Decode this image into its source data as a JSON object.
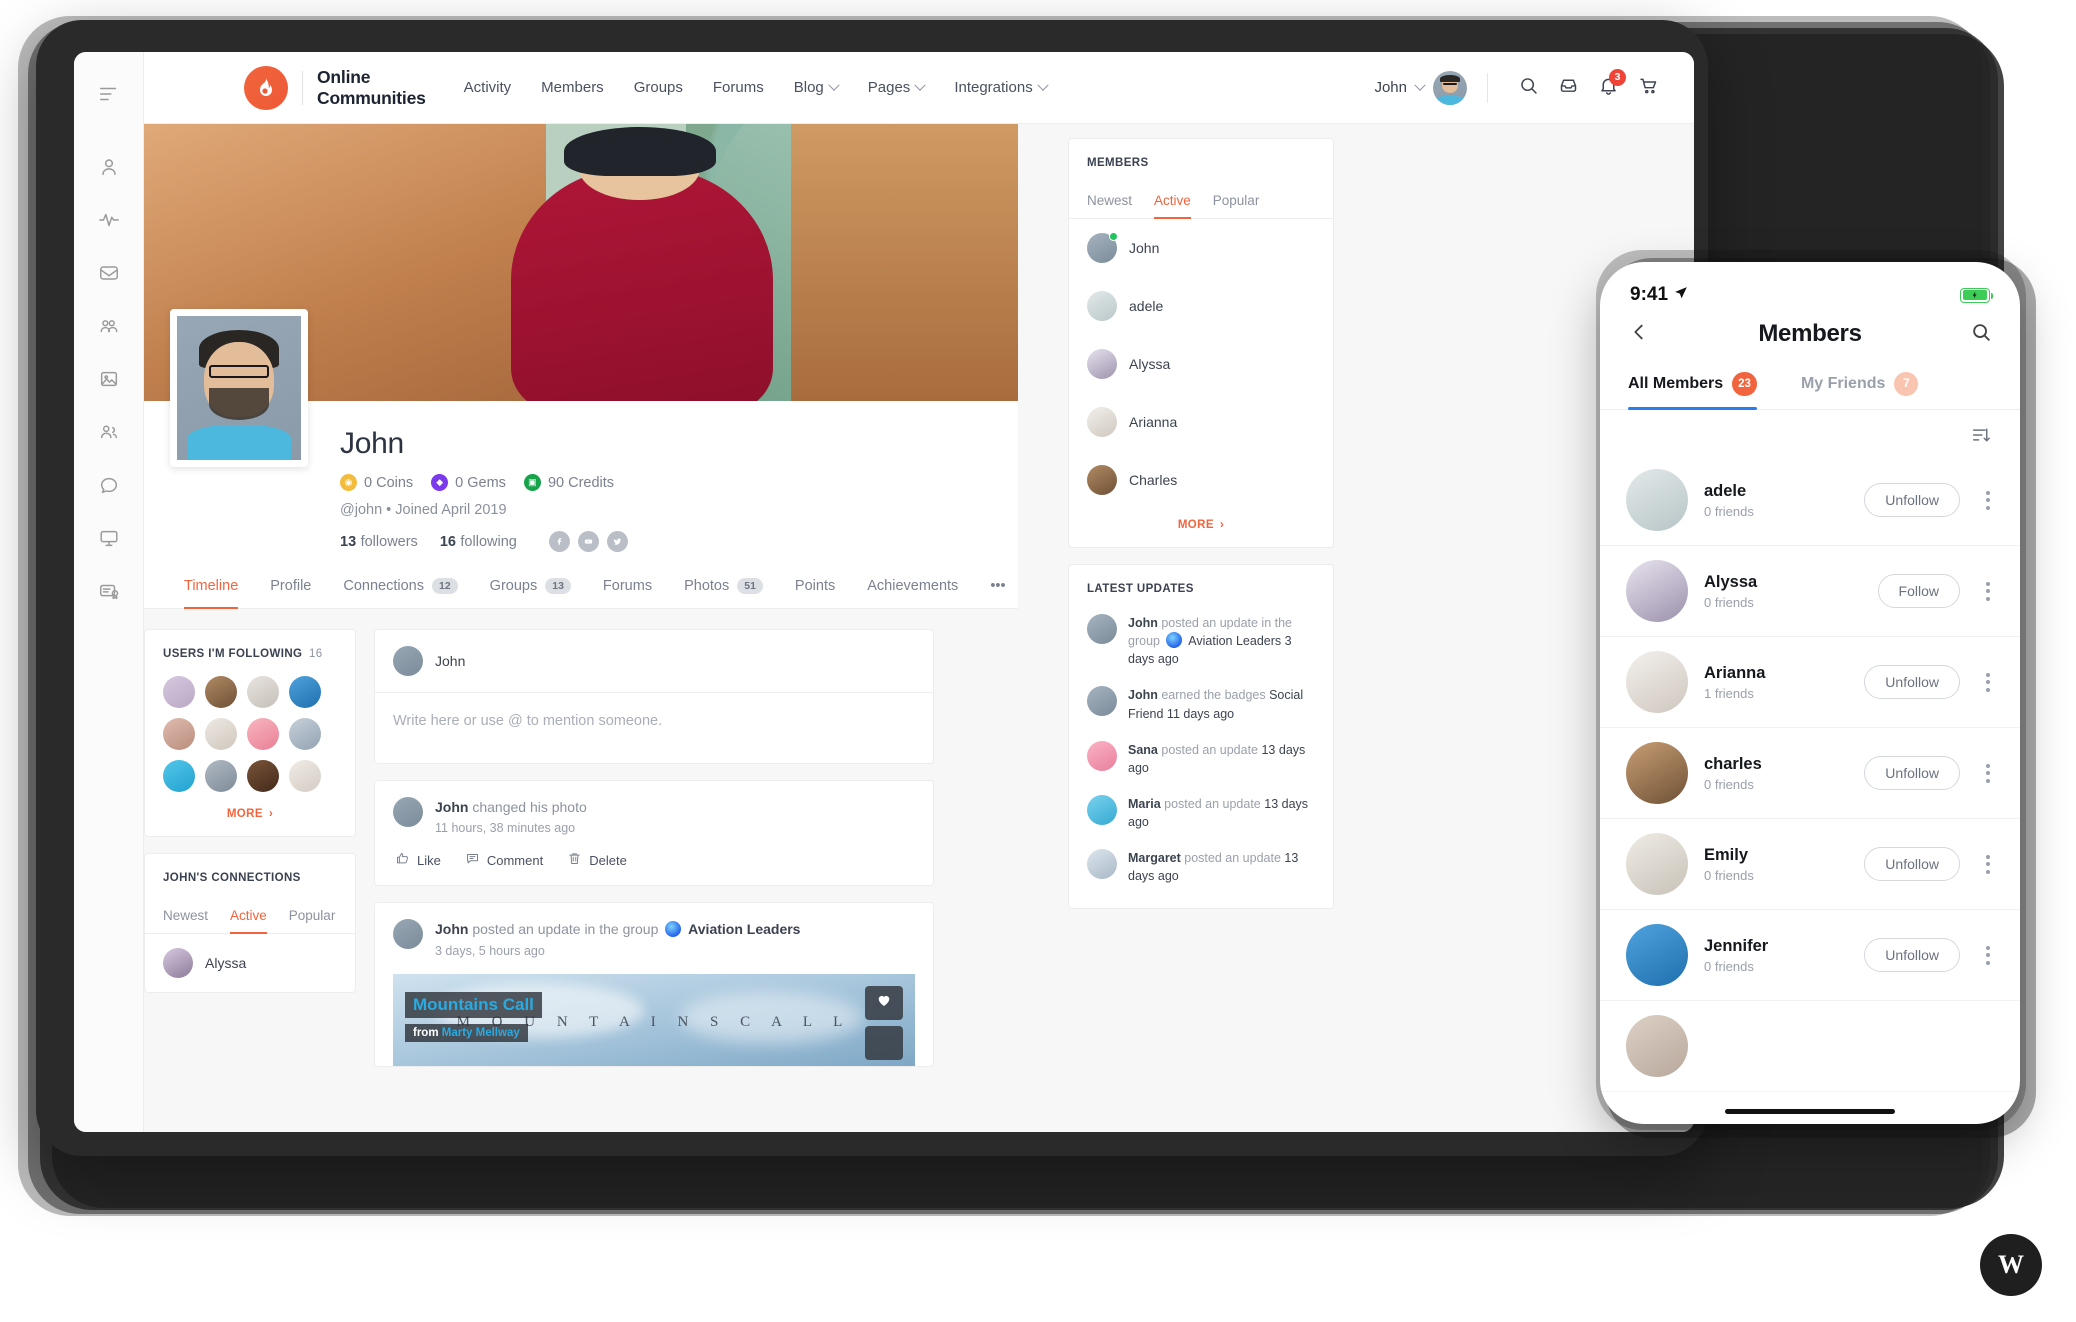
{
  "rail": {
    "items": [
      {
        "icon": "menu-icon",
        "name": "menu"
      },
      {
        "icon": "user-icon",
        "name": "profile"
      },
      {
        "icon": "activity-icon",
        "name": "activity"
      },
      {
        "icon": "inbox-icon",
        "name": "messages"
      },
      {
        "icon": "groups-icon",
        "name": "groups"
      },
      {
        "icon": "photo-icon",
        "name": "photos"
      },
      {
        "icon": "members-icon",
        "name": "members"
      },
      {
        "icon": "chat-icon",
        "name": "forums"
      },
      {
        "icon": "monitor-icon",
        "name": "courses"
      },
      {
        "icon": "certificate-icon",
        "name": "certificates"
      }
    ]
  },
  "header": {
    "brand_name": "Online\nCommunities",
    "logo_icon": "flame-logo-icon",
    "nav": [
      {
        "label": "Activity",
        "dropdown": false
      },
      {
        "label": "Members",
        "dropdown": false
      },
      {
        "label": "Groups",
        "dropdown": false
      },
      {
        "label": "Forums",
        "dropdown": false
      },
      {
        "label": "Blog",
        "dropdown": true
      },
      {
        "label": "Pages",
        "dropdown": true
      },
      {
        "label": "Integrations",
        "dropdown": true
      }
    ],
    "user_name": "John",
    "icons": [
      {
        "name": "search-icon"
      },
      {
        "name": "inbox-icon"
      },
      {
        "name": "bell-icon",
        "badge": "3"
      },
      {
        "name": "cart-icon"
      }
    ]
  },
  "profile": {
    "name": "John",
    "stats": [
      {
        "value": "0 Coins",
        "type": "coins",
        "glyph": "◉"
      },
      {
        "value": "0 Gems",
        "type": "gems",
        "glyph": "◆"
      },
      {
        "value": "90 Credits",
        "type": "credits",
        "glyph": "▣"
      }
    ],
    "meta": "@john • Joined April 2019",
    "followers_num": "13",
    "followers_label": "followers",
    "following_num": "16",
    "following_label": "following",
    "socials": [
      "facebook-icon",
      "youtube-icon",
      "twitter-icon"
    ],
    "tabs": [
      {
        "label": "Timeline",
        "count": null,
        "active": true
      },
      {
        "label": "Profile",
        "count": null,
        "active": false
      },
      {
        "label": "Connections",
        "count": "12",
        "active": false
      },
      {
        "label": "Groups",
        "count": "13",
        "active": false
      },
      {
        "label": "Forums",
        "count": null,
        "active": false
      },
      {
        "label": "Photos",
        "count": "51",
        "active": false
      },
      {
        "label": "Points",
        "count": null,
        "active": false
      },
      {
        "label": "Achievements",
        "count": null,
        "active": false
      },
      {
        "label": "•••",
        "count": null,
        "active": false
      }
    ]
  },
  "following_widget": {
    "title": "USERS I'M FOLLOWING",
    "count": "16",
    "more_label": "MORE",
    "avatars": [
      "#b9a8c4",
      "#9c7a5a",
      "#d8d2cc",
      "#2f86c8",
      "#c9a79a",
      "#ded7d0",
      "#f3a0ae",
      "#b9c4cf",
      "#3fb6e0",
      "#9aa6b2",
      "#6b4a35",
      "#e3ddd6"
    ]
  },
  "connections_widget": {
    "title": "JOHN'S CONNECTIONS",
    "subtabs": [
      {
        "label": "Newest",
        "active": false
      },
      {
        "label": "Active",
        "active": true
      },
      {
        "label": "Popular",
        "active": false
      }
    ],
    "rows": [
      {
        "name": "Alyssa",
        "color": "#b9a8c4"
      }
    ]
  },
  "composer": {
    "user": "John",
    "placeholder": "Write here or use @ to mention someone."
  },
  "feed": [
    {
      "actor": "John",
      "action": "changed his photo",
      "time": "11 hours, 38 minutes ago",
      "actions": [
        {
          "label": "Like",
          "icon": "thumbs-up-icon"
        },
        {
          "label": "Comment",
          "icon": "comment-icon"
        },
        {
          "label": "Delete",
          "icon": "trash-icon"
        }
      ]
    },
    {
      "actor": "John",
      "action": "posted an update in the group",
      "group": "Aviation Leaders",
      "time": "3 days, 5 hours ago",
      "embed": {
        "title": "Mountains Call",
        "from_prefix": "from",
        "from_author": "Marty Mellway",
        "watermark": "M O U N T A I N S   C A L L",
        "fav_icon": "heart-icon"
      }
    }
  ],
  "members_widget": {
    "title": "MEMBERS",
    "subtabs": [
      {
        "label": "Newest",
        "active": false
      },
      {
        "label": "Active",
        "active": true
      },
      {
        "label": "Popular",
        "active": false
      }
    ],
    "rows": [
      {
        "name": "John",
        "color": "#98a7b4",
        "online": true
      },
      {
        "name": "adele",
        "color": "#d7dfe0",
        "online": false
      },
      {
        "name": "Alyssa",
        "color": "#ded9e8",
        "online": false
      },
      {
        "name": "Arianna",
        "color": "#eceae6",
        "online": false
      },
      {
        "name": "Charles",
        "color": "#9c7a5a",
        "online": false
      }
    ],
    "more_label": "MORE"
  },
  "latest_updates": {
    "title": "LATEST UPDATES",
    "rows": [
      {
        "actor": "John",
        "action": "posted an update in the group",
        "target": "Aviation Leaders",
        "time": "3 days ago",
        "color": "#98a7b4",
        "has_group_icon": true
      },
      {
        "actor": "John",
        "action": "earned the badges",
        "target": "Social Friend",
        "time": "11 days ago",
        "color": "#98a7b4",
        "has_group_icon": false
      },
      {
        "actor": "Sana",
        "action": "posted an update",
        "target": "",
        "time": "13 days ago",
        "color": "#f49ab4",
        "has_group_icon": false
      },
      {
        "actor": "Maria",
        "action": "posted an update",
        "target": "",
        "time": "13 days ago",
        "color": "#5ec8e8",
        "has_group_icon": false
      },
      {
        "actor": "Margaret",
        "action": "posted an update",
        "target": "",
        "time": "13 days ago",
        "color": "#c7d3dd",
        "has_group_icon": false
      }
    ]
  },
  "phone": {
    "status_time": "9:41",
    "location_icon": "location-arrow-icon",
    "battery_icon": "battery-charging-icon",
    "back_icon": "chevron-left-icon",
    "title": "Members",
    "search_icon": "search-icon",
    "tabs": [
      {
        "label": "All Members",
        "badge": "23",
        "active": true
      },
      {
        "label": "My Friends",
        "badge": "7",
        "active": false
      }
    ],
    "sort_icon": "sort-descending-icon",
    "rows": [
      {
        "name": "adele",
        "friends": "0 friends",
        "button": "Unfollow",
        "color": "#d7dfe0"
      },
      {
        "name": "Alyssa",
        "friends": "0 friends",
        "button": "Follow",
        "color": "#ded9e8"
      },
      {
        "name": "Arianna",
        "friends": "1 friends",
        "button": "Unfollow",
        "color": "#eceae6"
      },
      {
        "name": "charles",
        "friends": "0 friends",
        "button": "Unfollow",
        "color": "#b6916b"
      },
      {
        "name": "Emily",
        "friends": "0 friends",
        "button": "Unfollow",
        "color": "#e9e6df"
      },
      {
        "name": "Jennifer",
        "friends": "0 friends",
        "button": "Unfollow",
        "color": "#2f86c8"
      }
    ]
  },
  "watermark": {
    "text": "W"
  },
  "colors": {
    "accent": "#f2643d",
    "badge_red": "#f04438",
    "online_green": "#22c55e",
    "phone_tab_blue": "#2a7ef0"
  }
}
